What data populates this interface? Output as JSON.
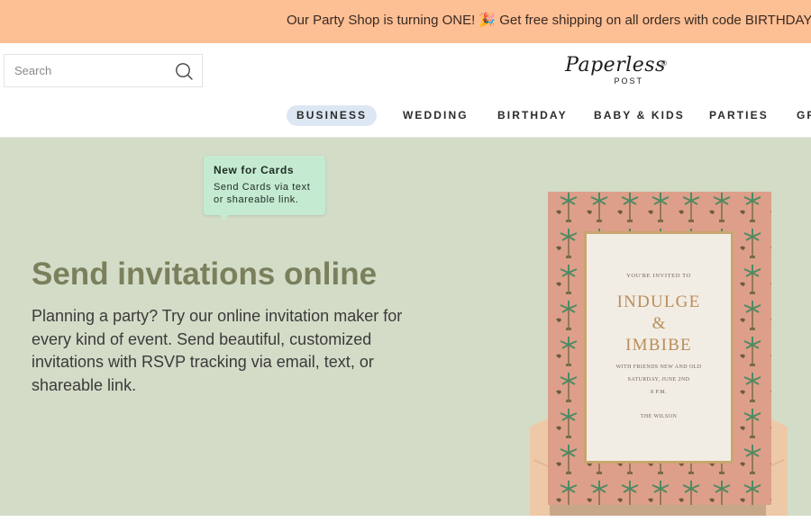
{
  "promo": {
    "text": "Our Party Shop is turning ONE! 🎉 Get free shipping on all orders with code BIRTHDAY."
  },
  "search": {
    "placeholder": "Search",
    "value": ""
  },
  "logo": {
    "word": "Paperless",
    "sub": "POST",
    "reg": "®"
  },
  "nav": {
    "items": [
      {
        "label": "BUSINESS",
        "active": true
      },
      {
        "label": "WEDDING"
      },
      {
        "label": "BIRTHDAY"
      },
      {
        "label": "BABY & KIDS"
      },
      {
        "label": "PARTIES"
      },
      {
        "label": "GR"
      }
    ]
  },
  "hero": {
    "badge_title": "New for Cards",
    "badge_body": "Send Cards via text or shareable link.",
    "title": "Send invitations online",
    "description": "Planning a party? Try our online invitation maker for every kind of event. Send beautiful, customized invitations with RSVP tracking via email, text, or shareable link."
  },
  "card": {
    "line1": "YOU'RE INVITED TO",
    "line2": "INDULGE",
    "line3": "&",
    "line4": "IMBIBE",
    "line5": "WITH FRIENDS NEW AND OLD",
    "line6": "SATURDAY, JUNE 2ND",
    "line7": "8 P.M.",
    "line8": "THE WILSON"
  },
  "colors": {
    "promo_bg": "#fdbf94",
    "hero_bg": "#d3dcc7",
    "badge_bg": "#c4ebd2",
    "title_color": "#7a7f5c",
    "nav_active_bg": "#dde7f3",
    "card_border": "#dd9f8a"
  },
  "icons": {
    "search": "search-icon",
    "promo_emoji": "party-popper-icon"
  }
}
